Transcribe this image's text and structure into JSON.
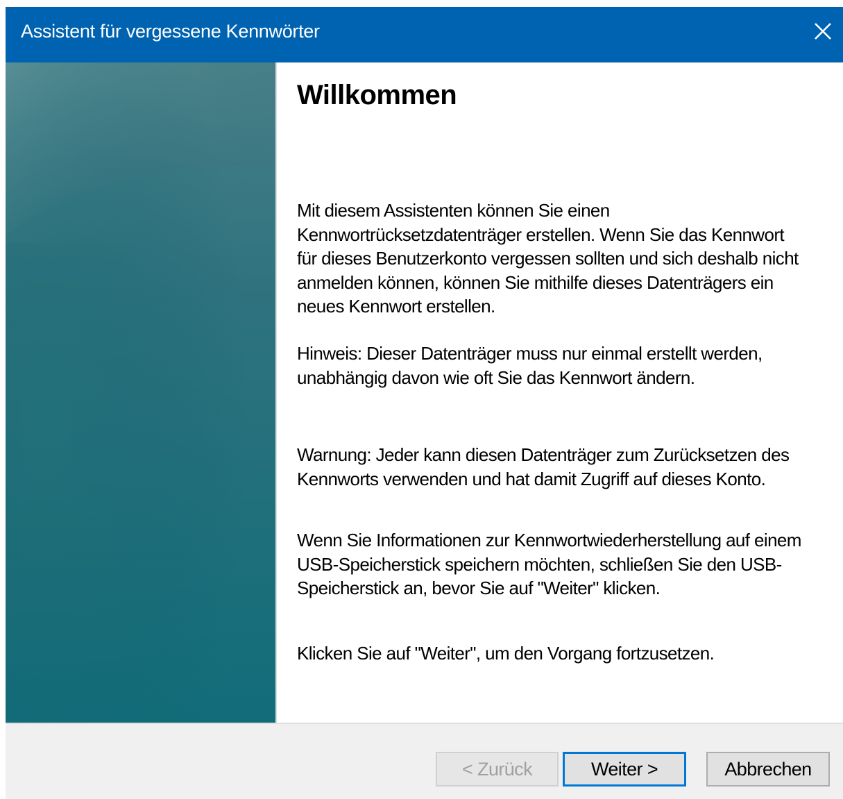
{
  "window": {
    "title": "Assistent für vergessene Kennwörter"
  },
  "page": {
    "heading": "Willkommen",
    "paragraphs": [
      "Mit diesem Assistenten können Sie einen Kennwortrücksetzdatenträger erstellen. Wenn Sie das Kennwort für dieses Benutzerkonto vergessen sollten und sich deshalb nicht anmelden können, können Sie mithilfe dieses Datenträgers ein neues Kennwort erstellen.",
      "Hinweis: Dieser Datenträger muss nur einmal erstellt werden, unabhängig davon wie oft Sie das Kennwort ändern.",
      "Warnung: Jeder kann diesen Datenträger zum Zurücksetzen des Kennworts verwenden und hat damit Zugriff auf dieses Konto.",
      "Wenn Sie Informationen zur Kennwortwiederherstellung auf einem USB-Speicherstick speichern möchten, schließen Sie den USB-Speicherstick an, bevor Sie auf \"Weiter\" klicken.",
      "Klicken Sie auf \"Weiter\", um den Vorgang fortzusetzen."
    ]
  },
  "buttons": {
    "back": "< Zurück",
    "next": "Weiter >",
    "cancel": "Abbrechen"
  },
  "colors": {
    "titlebar": "#0063b1",
    "sidebar_top": "#3d7a84",
    "sidebar_bottom": "#0f7a82"
  },
  "icons": {
    "close": "close-icon"
  }
}
